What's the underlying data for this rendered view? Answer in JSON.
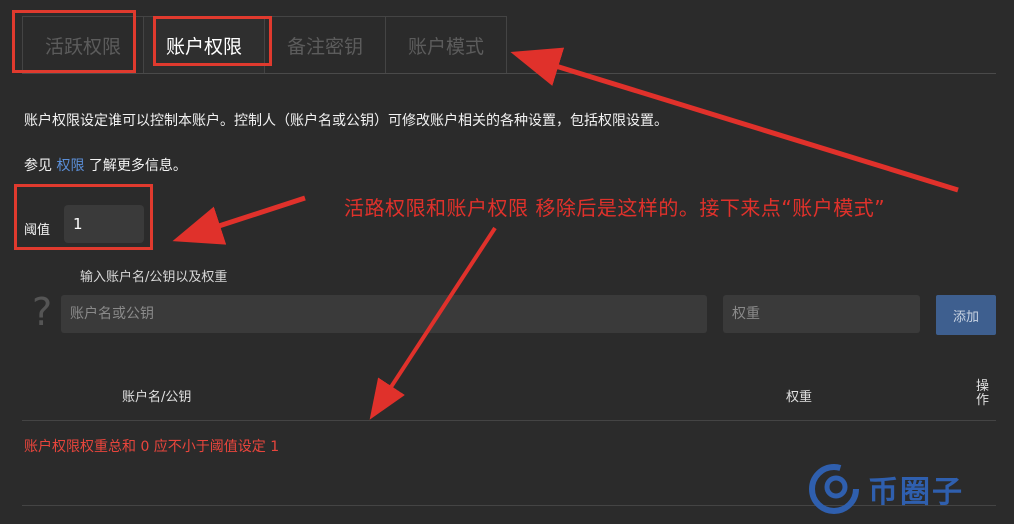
{
  "tabs": [
    {
      "label": "活跃权限",
      "active": false
    },
    {
      "label": "账户权限",
      "active": true
    },
    {
      "label": "备注密钥",
      "active": false
    },
    {
      "label": "账户模式",
      "active": false
    }
  ],
  "description": "账户权限设定谁可以控制本账户。控制人（账户名或公钥）可修改账户相关的各种设置，包括权限设置。",
  "see_also": {
    "prefix": "参见",
    "link": "权限",
    "suffix": "了解更多信息。"
  },
  "threshold": {
    "label": "阈值",
    "value": "1"
  },
  "input_section": {
    "title": "输入账户名/公钥以及权重",
    "help_glyph": "?",
    "name_placeholder": "账户名或公钥",
    "weight_placeholder": "权重",
    "add_label": "添加"
  },
  "table": {
    "col_name": "账户名/公钥",
    "col_weight": "权重",
    "col_ops": "操作"
  },
  "error_text": "账户权限权重总和 0 应不小于阈值设定 1",
  "annotation": "活路权限和账户权限 移除后是这样的。接下来点“账户模式”",
  "watermark": {
    "text": "币圈子",
    "icon": "coin-logo-icon"
  },
  "colors": {
    "annotation": "#e0312b",
    "link": "#5b8fd8",
    "error": "#e8453c",
    "button": "#3e5f8f"
  }
}
